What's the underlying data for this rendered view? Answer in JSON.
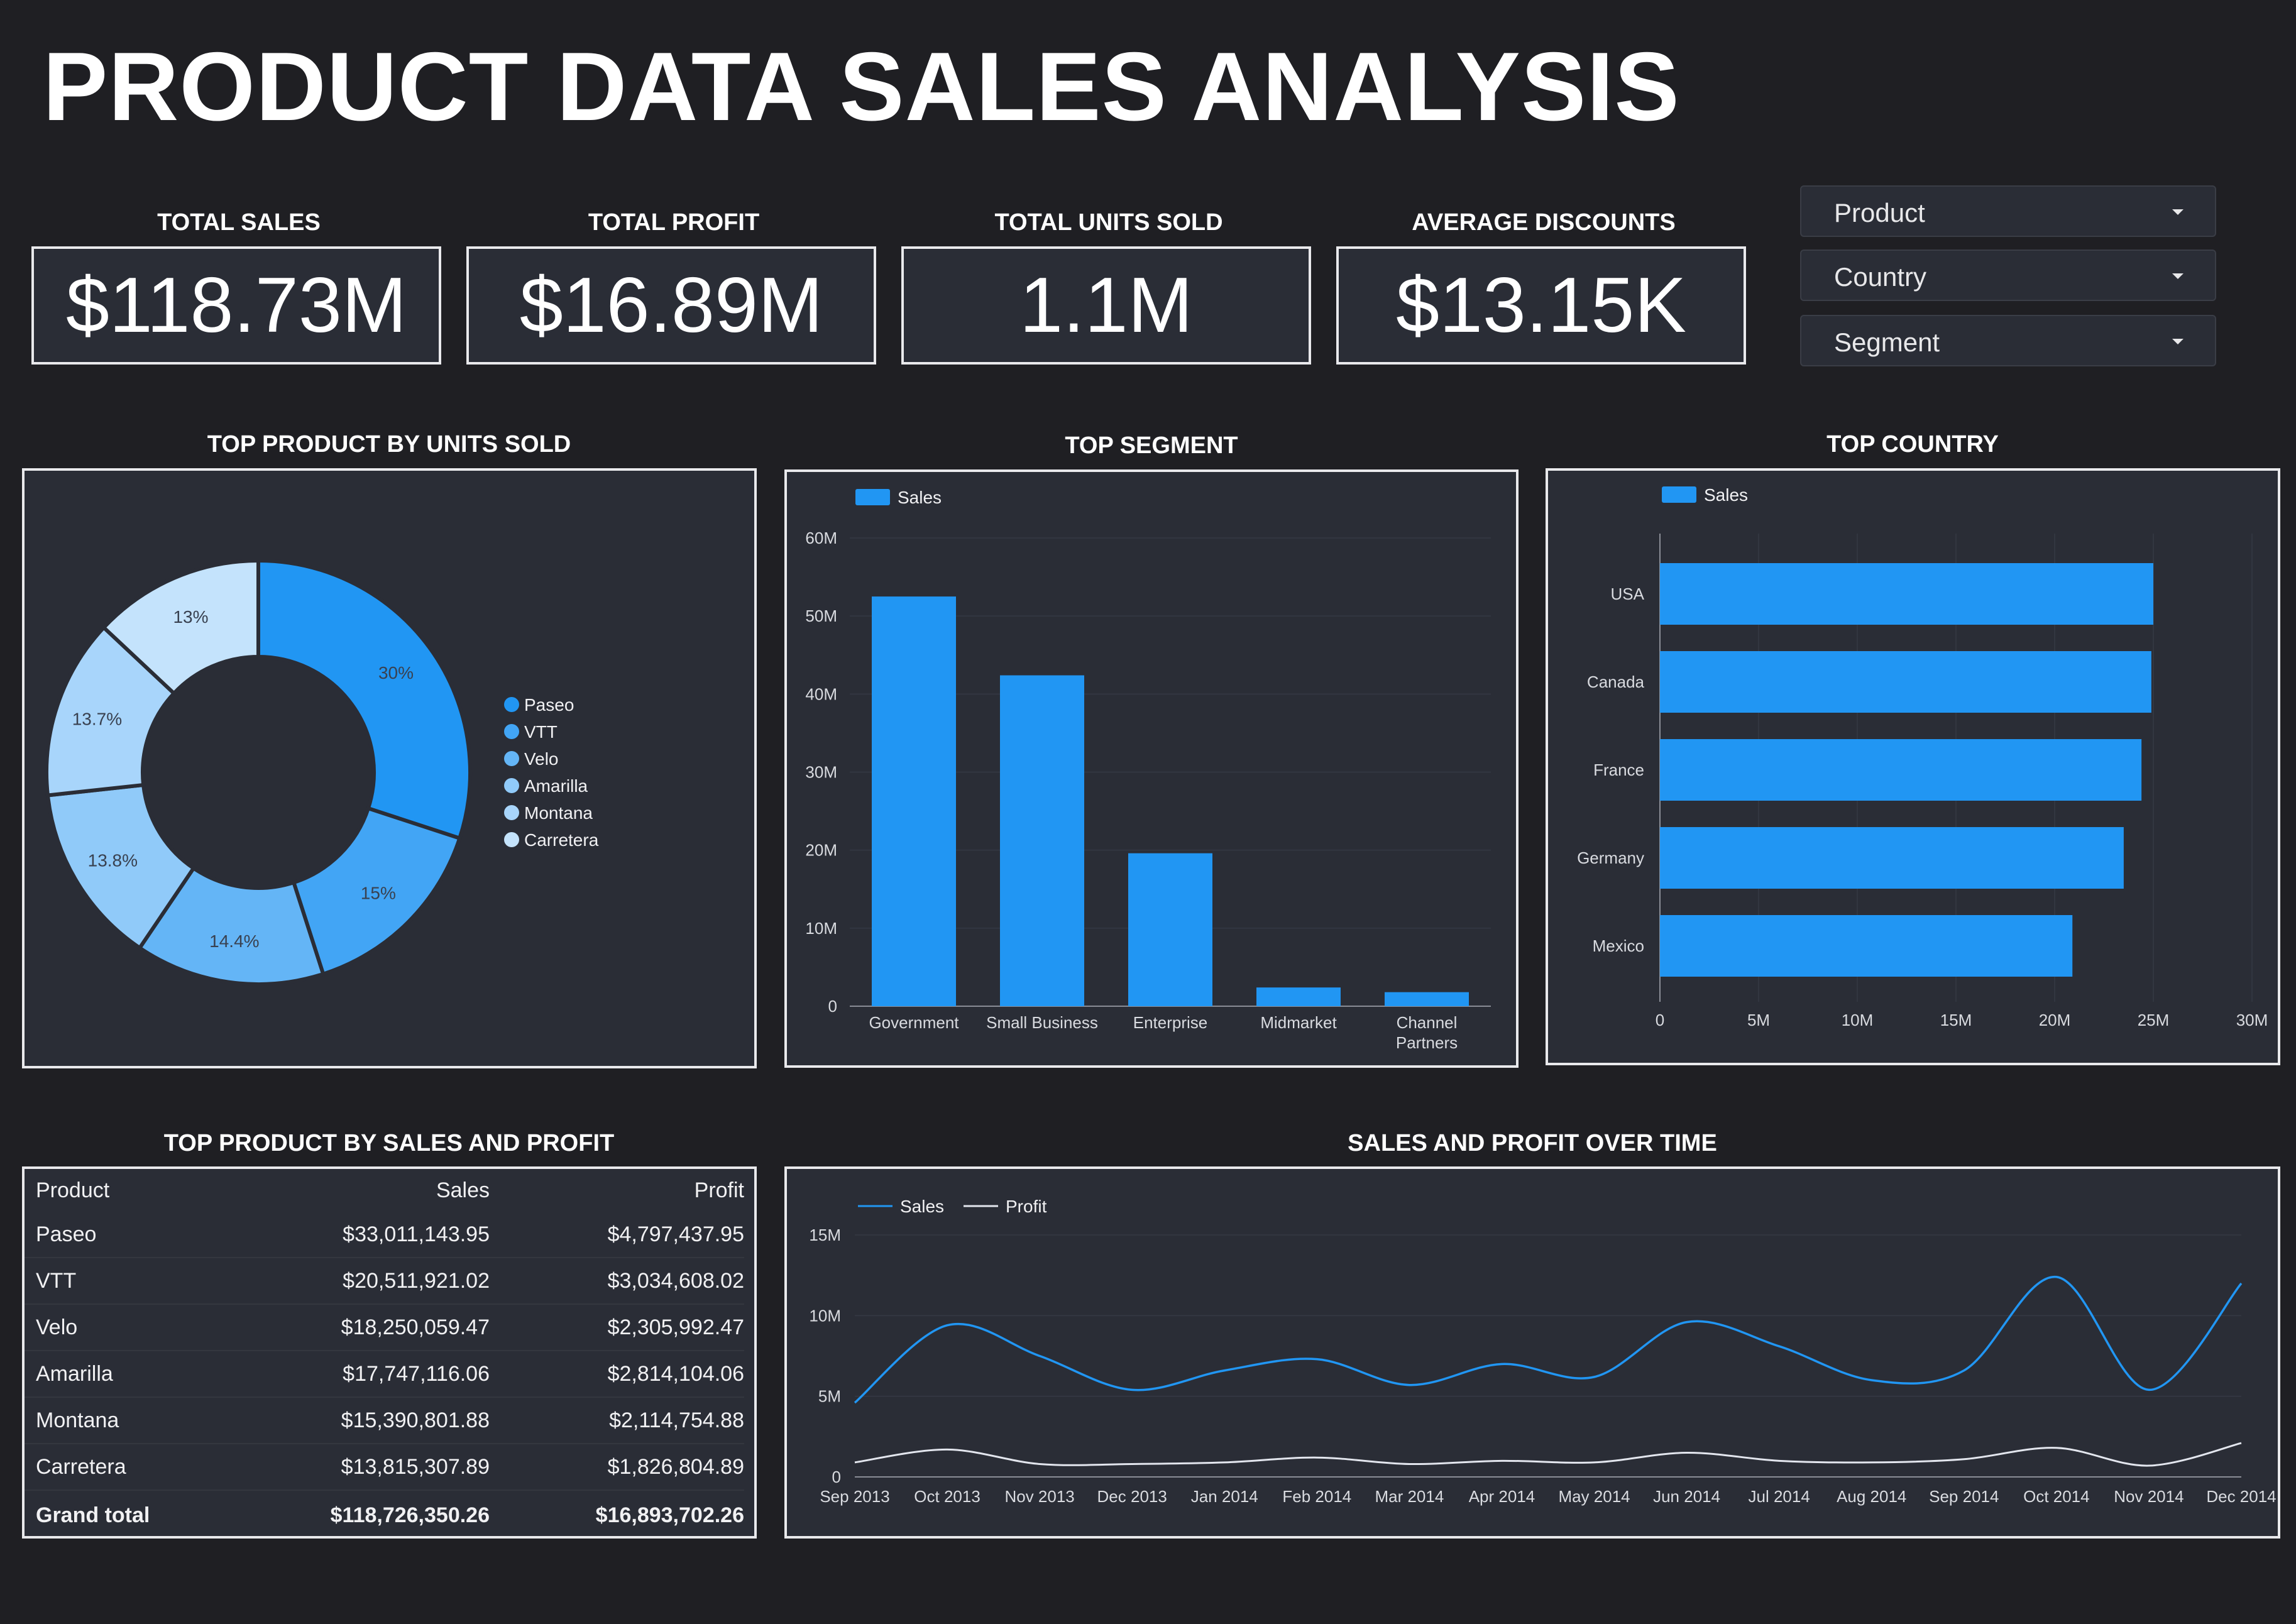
{
  "title": "PRODUCT DATA SALES ANALYSIS",
  "kpis": [
    {
      "label": "TOTAL SALES",
      "value": "$118.73M"
    },
    {
      "label": "TOTAL PROFIT",
      "value": "$16.89M"
    },
    {
      "label": "TOTAL UNITS SOLD",
      "value": "1.1M"
    },
    {
      "label": "AVERAGE DISCOUNTS",
      "value": "$13.15K"
    }
  ],
  "filters": [
    "Product",
    "Country",
    "Segment"
  ],
  "sections": {
    "donut": "TOP PRODUCT BY UNITS SOLD",
    "segment": "TOP SEGMENT",
    "country": "TOP COUNTRY",
    "table": "TOP PRODUCT BY SALES AND PROFIT",
    "line": "SALES AND PROFIT OVER TIME"
  },
  "colors": {
    "background": "#1f1f23",
    "panel": "#2a2d36",
    "accent": "#2196f3",
    "profit_line": "#e3e6ee"
  },
  "table": {
    "columns": [
      "Product",
      "Sales",
      "Profit"
    ],
    "rows": [
      [
        "Paseo",
        "$33,011,143.95",
        "$4,797,437.95"
      ],
      [
        "VTT",
        "$20,511,921.02",
        "$3,034,608.02"
      ],
      [
        "Velo",
        "$18,250,059.47",
        "$2,305,992.47"
      ],
      [
        "Amarilla",
        "$17,747,116.06",
        "$2,814,104.06"
      ],
      [
        "Montana",
        "$15,390,801.88",
        "$2,114,754.88"
      ],
      [
        "Carretera",
        "$13,815,307.89",
        "$1,826,804.89"
      ]
    ],
    "grand_total": [
      "Grand total",
      "$118,726,350.26",
      "$16,893,702.26"
    ]
  },
  "chart_data": [
    {
      "type": "pie",
      "title": "TOP PRODUCT BY UNITS SOLD",
      "categories": [
        "Paseo",
        "VTT",
        "Velo",
        "Amarilla",
        "Montana",
        "Carretera"
      ],
      "values": [
        30,
        15,
        14.4,
        13.8,
        13.7,
        13
      ],
      "labels": [
        "30%",
        "15%",
        "14.4%",
        "13.8%",
        "13.7%",
        "13%"
      ],
      "colors": [
        "#2196f3",
        "#42a5f5",
        "#64b5f6",
        "#90caf9",
        "#a8d5fb",
        "#c4e3fc"
      ],
      "legend": "right"
    },
    {
      "type": "bar",
      "title": "TOP SEGMENT",
      "categories": [
        "Government",
        "Small Business",
        "Enterprise",
        "Midmarket",
        "Channel Partners"
      ],
      "series": [
        {
          "name": "Sales",
          "values": [
            52.5,
            42.4,
            19.6,
            2.4,
            1.8
          ]
        }
      ],
      "ylim": [
        0,
        60
      ],
      "ticks": [
        "0",
        "10M",
        "20M",
        "30M",
        "40M",
        "50M",
        "60M"
      ],
      "legend": "top-left"
    },
    {
      "type": "bar",
      "orientation": "horizontal",
      "title": "TOP COUNTRY",
      "categories": [
        "USA",
        "Canada",
        "France",
        "Germany",
        "Mexico"
      ],
      "series": [
        {
          "name": "Sales",
          "values": [
            25.0,
            24.9,
            24.4,
            23.5,
            20.9
          ]
        }
      ],
      "xlim": [
        0,
        30
      ],
      "ticks": [
        "0",
        "5M",
        "10M",
        "15M",
        "20M",
        "25M",
        "30M"
      ],
      "legend": "top-left"
    },
    {
      "type": "line",
      "title": "SALES AND PROFIT OVER TIME",
      "x": [
        "Sep 2013",
        "Oct 2013",
        "Nov 2013",
        "Dec 2013",
        "Jan 2014",
        "Feb 2014",
        "Mar 2014",
        "Apr 2014",
        "May 2014",
        "Jun 2014",
        "Jul 2014",
        "Aug 2014",
        "Sep 2014",
        "Oct 2014",
        "Nov 2014",
        "Dec 2014"
      ],
      "series": [
        {
          "name": "Sales",
          "values": [
            4.6,
            9.4,
            7.5,
            5.4,
            6.6,
            7.3,
            5.7,
            7.0,
            6.2,
            9.6,
            8.1,
            6.0,
            6.6,
            12.4,
            5.4,
            12.0
          ]
        },
        {
          "name": "Profit",
          "values": [
            0.9,
            1.7,
            0.8,
            0.8,
            0.9,
            1.2,
            0.8,
            1.0,
            0.9,
            1.5,
            1.0,
            0.9,
            1.1,
            1.8,
            0.7,
            2.1
          ]
        }
      ],
      "ylim": [
        0,
        15
      ],
      "ticks": [
        "0",
        "5M",
        "10M",
        "15M"
      ],
      "legend": "top-left"
    }
  ]
}
